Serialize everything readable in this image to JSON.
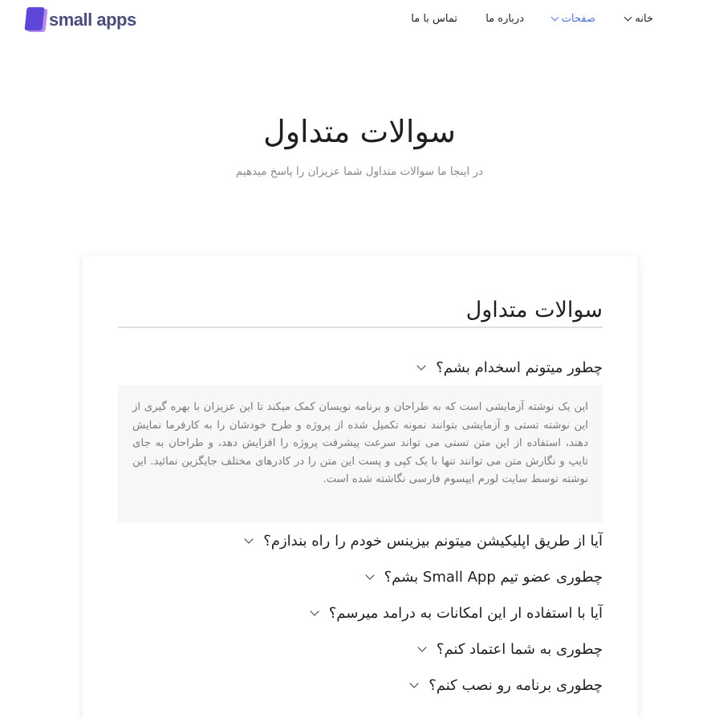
{
  "header": {
    "logo_text": "small apps",
    "nav": {
      "home": "خانه",
      "pages": "صفحات",
      "about": "درباره ما",
      "contact": "تماس با ما"
    },
    "active_color": "#4f6fd8"
  },
  "hero": {
    "title": "سوالات متداول",
    "subtitle": "در اینجا ما سوالات متداول شما عزیزان را پاسخ میدهیم"
  },
  "faq": {
    "title": "سوالات متداول",
    "items": [
      {
        "question": "چطور میتونم اسخدام بشم؟",
        "expanded": true,
        "answer": "این یک نوشته آزمایشی است که به طراحان و برنامه نویسان کمک میکند تا این عزیزان با بهره گیری از این نوشته تستی و آزمایشی بتوانند نمونه تکمیل شده از پروژه و طرح خودشان را به کارفرما نمایش دهند، استفاده از این متن تستی می تواند سرعت پیشرفت پروژه را افزایش دهد، و طراحان به جای تایپ و نگارش متن می توانند تنها با یک کپی و پست این متن را در کادرهای مختلف جایگزین نمائید. این نوشته توسط سایت لورم ایپسوم فارسی نگاشته شده است."
      },
      {
        "question": "آیا از طریق اپلیکیشن میتونم بیزینس خودم را راه بندازم؟",
        "expanded": false
      },
      {
        "question": "چطوری عضو تیم Small App بشم؟",
        "expanded": false
      },
      {
        "question": "آیا با استفاده ار این امکانات به درامد میرسم؟",
        "expanded": false
      },
      {
        "question": "چطوری به شما اعتماد کنم؟",
        "expanded": false
      },
      {
        "question": "چطوری برنامه رو نصب کنم؟",
        "expanded": false
      }
    ]
  }
}
